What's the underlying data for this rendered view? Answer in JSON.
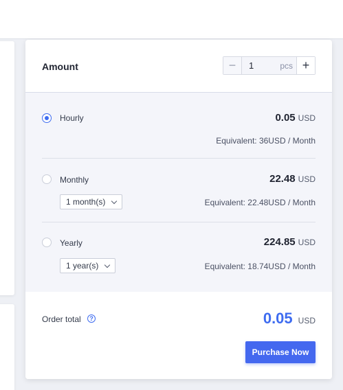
{
  "amount": {
    "label": "Amount",
    "quantity": "1",
    "unit": "pcs",
    "minus_symbol": "−",
    "plus_symbol": "+"
  },
  "plans": [
    {
      "label": "Hourly",
      "price": "0.05",
      "currency": "USD",
      "equivalent": "Equivalent: 36USD / Month",
      "selected": true
    },
    {
      "label": "Monthly",
      "price": "22.48",
      "currency": "USD",
      "equivalent": "Equivalent: 22.48USD / Month",
      "duration": "1 month(s)",
      "selected": false
    },
    {
      "label": "Yearly",
      "price": "224.85",
      "currency": "USD",
      "equivalent": "Equivalent: 18.74USD / Month",
      "duration": "1 year(s)",
      "selected": false
    }
  ],
  "order_total": {
    "label": "Order total",
    "help_symbol": "?",
    "price": "0.05",
    "currency": "USD"
  },
  "purchase_button": "Purchase Now",
  "colors": {
    "accent": "#3e6cf0",
    "button": "#4468ef",
    "options_bg": "#f4f5fa"
  }
}
